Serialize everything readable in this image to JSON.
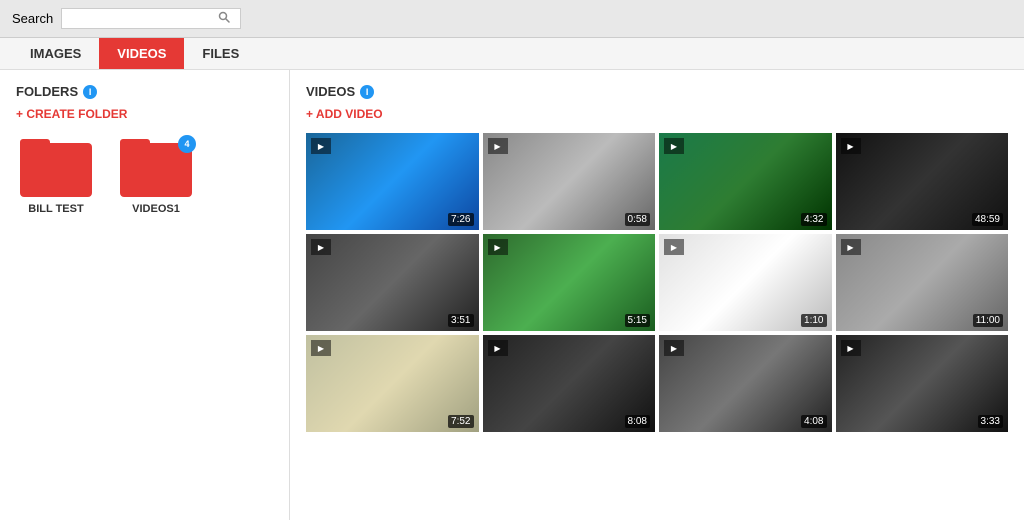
{
  "topBar": {
    "searchLabel": "Search",
    "searchPlaceholder": ""
  },
  "tabs": [
    {
      "id": "images",
      "label": "IMAGES",
      "active": false
    },
    {
      "id": "videos",
      "label": "VIDEOS",
      "active": true
    },
    {
      "id": "files",
      "label": "FILES",
      "active": false
    }
  ],
  "sidebar": {
    "foldersTitle": "FOLDERS",
    "infoIcon": "i",
    "createFolderLabel": "+ CREATE FOLDER",
    "folders": [
      {
        "name": "BILL TEST",
        "badge": null
      },
      {
        "name": "VIDEOS1",
        "badge": "4"
      }
    ]
  },
  "content": {
    "videosTitle": "VIDEOS",
    "infoIcon": "i",
    "addVideoLabel": "+ ADD VIDEO",
    "videos": [
      {
        "duration": "7:26",
        "colorClass": "thumb-color-1",
        "row": 0
      },
      {
        "duration": "0:58",
        "colorClass": "thumb-color-2",
        "row": 0
      },
      {
        "duration": "4:32",
        "colorClass": "thumb-color-3",
        "row": 0
      },
      {
        "duration": "48:59",
        "colorClass": "thumb-color-4",
        "row": 0
      },
      {
        "duration": "3:51",
        "colorClass": "thumb-color-5",
        "row": 1
      },
      {
        "duration": "5:15",
        "colorClass": "thumb-color-6",
        "row": 1
      },
      {
        "duration": "1:10",
        "colorClass": "thumb-color-7",
        "row": 1
      },
      {
        "duration": "11:00",
        "colorClass": "thumb-color-8",
        "row": 1
      },
      {
        "duration": "7:52",
        "colorClass": "thumb-color-9",
        "row": 2
      },
      {
        "duration": "8:08",
        "colorClass": "thumb-color-10",
        "row": 2
      },
      {
        "duration": "4:08",
        "colorClass": "thumb-color-11",
        "row": 2
      },
      {
        "duration": "3:33",
        "colorClass": "thumb-color-12",
        "row": 2
      }
    ]
  }
}
